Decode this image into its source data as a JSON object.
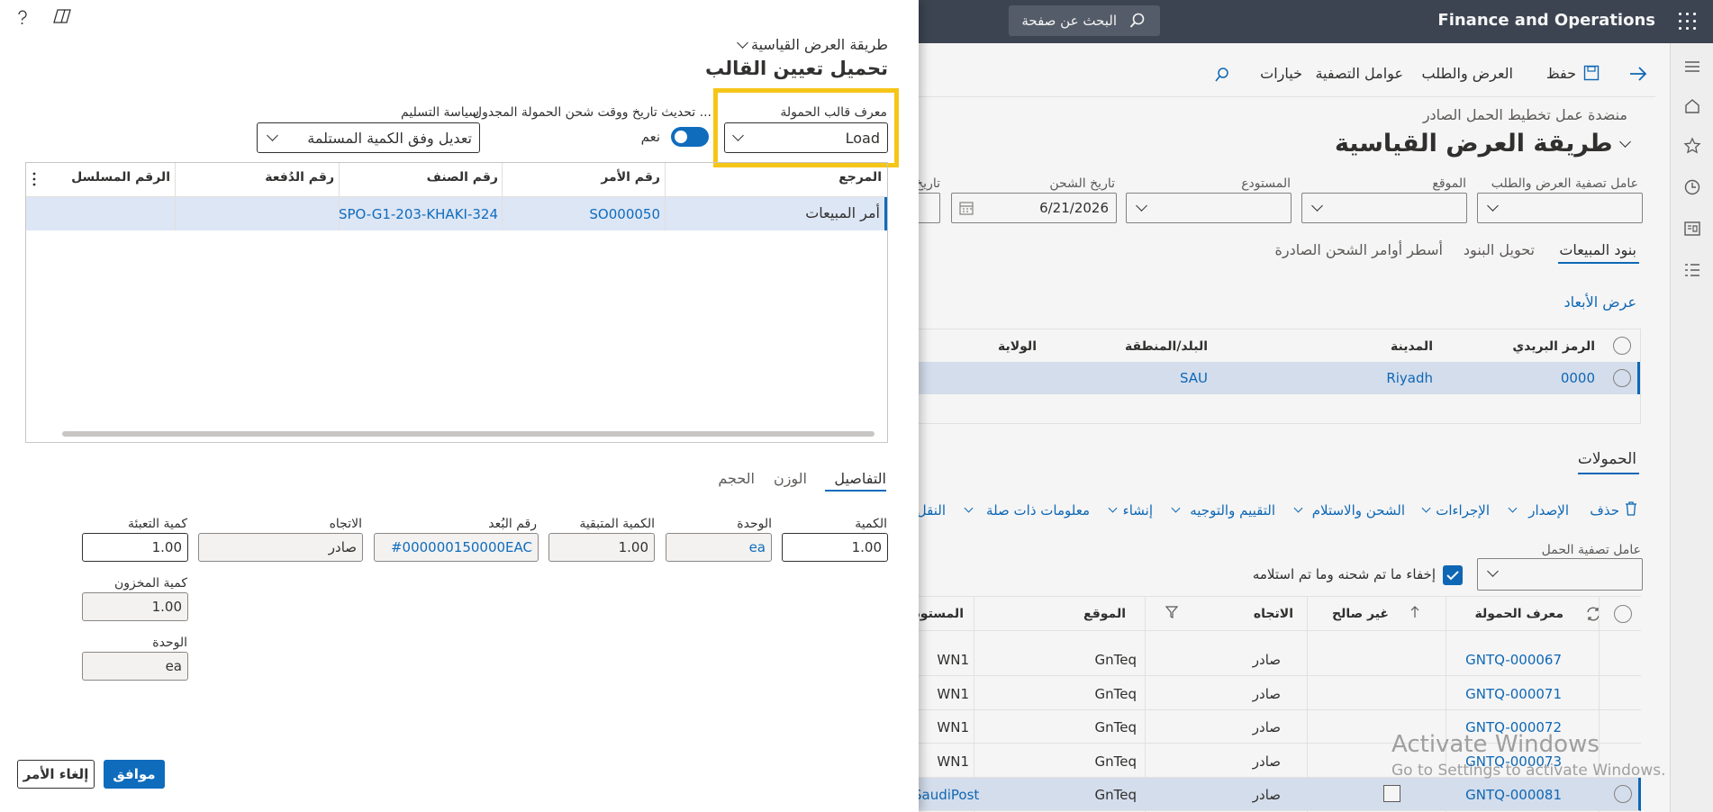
{
  "app": {
    "title": "Finance and Operations",
    "search_placeholder": "البحث عن صفحة"
  },
  "actionbar": {
    "save": "حفظ",
    "supply_demand": "العرض والطلب",
    "filter_factors": "عوامل التصفية",
    "options": "خيارات"
  },
  "page": {
    "breadcrumb": "منضدة عمل تخطيط الحمل الصادر",
    "title": "طريقة العرض القياسية"
  },
  "filters": {
    "supply_demand_filter_label": "عامل تصفية العرض والطلب",
    "site_label": "الموقع",
    "warehouse_label": "المستودع",
    "ship_date_label": "تاريخ الشحن",
    "ship_date_value": "6/21/2026",
    "partial_label": "تاريخ"
  },
  "tabs": {
    "sales_lines": "بنود المبيعات",
    "transfer_lines": "تحويل البنود",
    "outbound_shipment_lines": "أسطر أوامر الشحن الصادرة"
  },
  "dimensions_link": "عرض الأبعاد",
  "address_grid": {
    "headers": {
      "zip": "الرمز البريدي",
      "city": "المدينة",
      "country": "البلد/المنطقة",
      "state": "الولاية"
    },
    "row": {
      "zip": "0000",
      "city": "Riyadh",
      "country": "SAU"
    }
  },
  "loads": {
    "tab": "الحمولات",
    "toolbar": [
      "حذف",
      "الإصدار",
      "الإجراءات",
      "الشحن والاستلام",
      "التقييم والتوجيه",
      "إنشاء",
      "معلومات ذات صلة",
      "النقل"
    ],
    "load_filter_label": "عامل تصفية الحمل",
    "hide_label": "إخفاء ما تم شحنه وما تم استلامه",
    "headers": {
      "load_id": "معرف الحمولة",
      "invalid": "غير صالح",
      "direction": "الاتجاه",
      "site": "الموقع",
      "warehouse": "المستودع"
    },
    "rows": [
      {
        "load_id": "GNTQ-000067",
        "direction": "صادر",
        "site": "GnTeq",
        "warehouse": "WN1"
      },
      {
        "load_id": "GNTQ-000071",
        "direction": "صادر",
        "site": "GnTeq",
        "warehouse": "WN1"
      },
      {
        "load_id": "GNTQ-000072",
        "direction": "صادر",
        "site": "GnTeq",
        "warehouse": "WN1"
      },
      {
        "load_id": "GNTQ-000073",
        "direction": "صادر",
        "site": "GnTeq",
        "warehouse": "WN1"
      },
      {
        "load_id": "GNTQ-000081",
        "direction": "صادر",
        "site": "GnTeq",
        "warehouse": "SaudiPost"
      }
    ]
  },
  "watermark": {
    "line1": "Activate Windows",
    "line2": "Go to Settings to activate Windows."
  },
  "panel": {
    "view_dropdown": "طريقة العرض القياسية",
    "title": "تحميل تعيين القالب",
    "load_template_label": "معرف قالب الحمولة",
    "load_template_value": "Load",
    "update_date_label": "تحديث تاريخ ووقت شحن الحمولة المجدول ...",
    "toggle_value": "نعم",
    "delivery_policy_label": "سياسة التسليم",
    "delivery_policy_value": "تعديل وفق الكمية المستلمة",
    "grid": {
      "headers": {
        "reference": "المرجع",
        "order_no": "رقم الأمر",
        "item_no": "رقم الصنف",
        "batch_no": "رقم الدُفعة",
        "serial_no": "الرقم المسلسل"
      },
      "row": {
        "reference": "أمر المبيعات",
        "order_no": "SO000050",
        "item_no": "SPO-G1-203-KHAKI-324"
      }
    },
    "tabs": {
      "details": "التفاصيل",
      "weight": "الوزن",
      "volume": "الحجم"
    },
    "details": {
      "qty_label": "الكمية",
      "qty_value": "1.00",
      "unit_label": "الوحدة",
      "unit_value": "ea",
      "remaining_label": "الكمية المتبقية",
      "remaining_value": "1.00",
      "dimension_label": "رقم البُعد",
      "dimension_value": "#000000150000EAC",
      "direction_label": "الاتجاه",
      "direction_value": "صادر",
      "pack_qty_label": "كمية التعبئة",
      "pack_qty_value": "1.00",
      "inventory_qty_label": "كمية المخزون",
      "inventory_qty_value": "1.00",
      "inv_unit_label": "الوحدة",
      "inv_unit_value": "ea"
    },
    "ok": "موافق",
    "cancel": "إلغاء الأمر"
  }
}
